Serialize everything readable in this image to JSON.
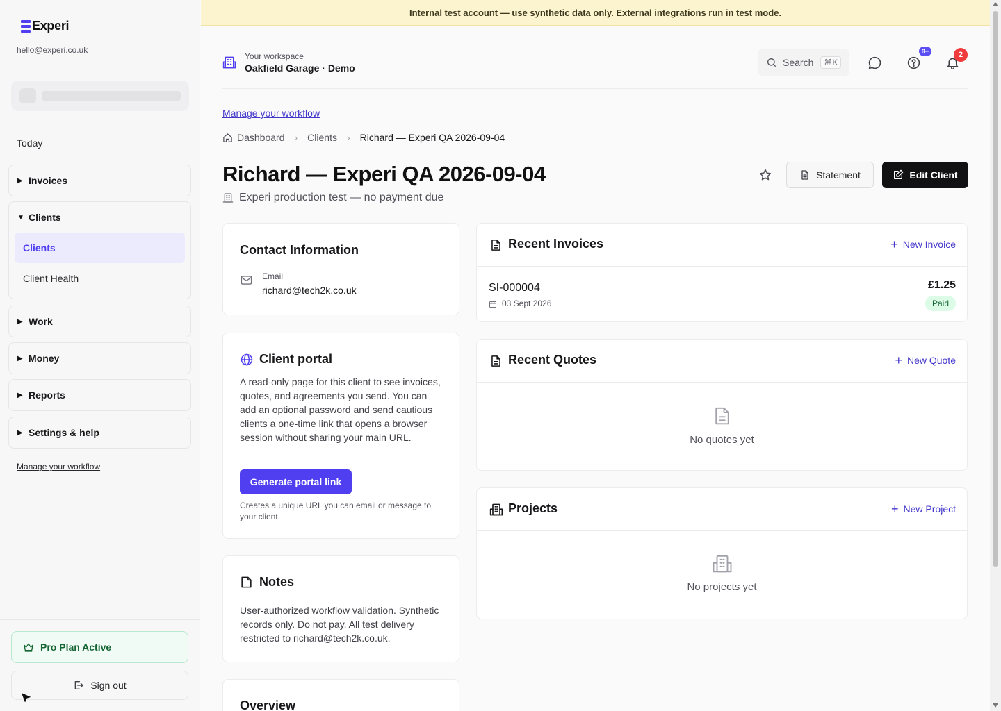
{
  "banner": {
    "text": "Internal test account — use synthetic data only. External integrations run in test mode."
  },
  "sidebar": {
    "brand": "Experi",
    "email": "hello@experi.co.uk",
    "today_label": "Today",
    "groups": {
      "invoices": {
        "label": "Invoices",
        "expanded": false
      },
      "clients": {
        "label": "Clients",
        "expanded": true,
        "items": [
          "Clients",
          "Client Health"
        ]
      },
      "work": {
        "label": "Work",
        "expanded": false
      },
      "money": {
        "label": "Money",
        "expanded": false
      },
      "reports": {
        "label": "Reports",
        "expanded": false
      },
      "settings": {
        "label": "Settings & help",
        "expanded": false
      }
    },
    "manage_link": "Manage your workflow",
    "pro_plan": "Pro Plan Active",
    "sign_out": "Sign out"
  },
  "topbar": {
    "workspace_label": "Your workspace",
    "workspace_name": "Oakfield Garage · Demo",
    "search_label": "Search",
    "search_shortcut": "⌘K",
    "help_badge": "9+",
    "notifications_badge": "2"
  },
  "manage_link": "Manage your workflow",
  "breadcrumb": {
    "dashboard": "Dashboard",
    "clients": "Clients",
    "current": "Richard — Experi QA 2026-09-04"
  },
  "client": {
    "title": "Richard — Experi QA 2026-09-04",
    "subtitle": "Experi production test — no payment due",
    "statement_button": "Statement",
    "edit_button": "Edit Client"
  },
  "contact": {
    "title": "Contact Information",
    "email_label": "Email",
    "email": "richard@tech2k.co.uk"
  },
  "portal": {
    "title": "Client portal",
    "description": "A read-only page for this client to see invoices, quotes, and agreements you send. You can add an optional password and send cautious clients a one-time link that opens a browser session without sharing your main URL.",
    "button": "Generate portal link",
    "help": "Creates a unique URL you can email or message to your client."
  },
  "notes": {
    "title": "Notes",
    "text": "User-authorized workflow validation. Synthetic records only. Do not pay. All test delivery restricted to richard@tech2k.co.uk."
  },
  "overview": {
    "title": "Overview"
  },
  "recent_invoices": {
    "title": "Recent Invoices",
    "action": "New Invoice",
    "rows": [
      {
        "number": "SI-000004",
        "date": "03 Sept 2026",
        "amount": "£1.25",
        "status": "Paid"
      }
    ]
  },
  "recent_quotes": {
    "title": "Recent Quotes",
    "action": "New Quote",
    "empty": "No quotes yet"
  },
  "projects": {
    "title": "Projects",
    "action": "New Project",
    "empty": "No projects yet"
  },
  "colors": {
    "accent": "#4f3ff0",
    "link": "#4338ca",
    "banner": "#fcf3cf",
    "success": "#166534",
    "badge_red": "#ef3b3b"
  }
}
